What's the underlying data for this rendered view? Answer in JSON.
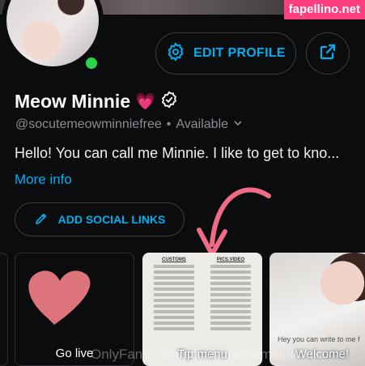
{
  "watermark": "fapellino.net",
  "profile": {
    "display_name": "Meow Minnie",
    "name_emoji": "💗",
    "handle": "@socutemeowminniefree",
    "status": "Available",
    "bio": "Hello! You can call me Minnie. I like to get to kno...",
    "more_info_label": "More info",
    "online": true,
    "verified": true
  },
  "actions": {
    "edit_profile_label": "EDIT PROFILE",
    "add_social_label": "ADD SOCIAL LINKS"
  },
  "colors": {
    "accent": "#00aff0",
    "background": "#0b0c0e",
    "online": "#2bd34a",
    "arrow": "#f06b86"
  },
  "icons": {
    "edit": "gear-icon",
    "share": "share-icon",
    "social": "pencil-icon",
    "verified": "verified-badge-icon",
    "status": "chevron-down-icon"
  },
  "tiles": [
    {
      "label": ""
    },
    {
      "label": "Go live"
    },
    {
      "label": "Tip menu",
      "menu_headers": [
        "CUSTOMS",
        "PICS.VIDEO"
      ]
    },
    {
      "label": "Welcome!",
      "caption": "Hey you can write to me f"
    }
  ],
  "footer_watermark": "OnlyFans.com/socutemeowminniefree"
}
